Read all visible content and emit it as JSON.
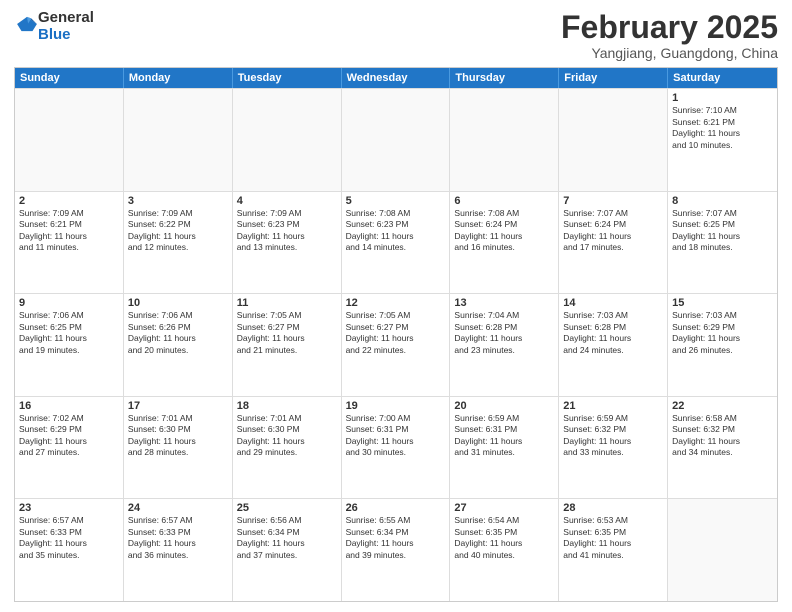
{
  "header": {
    "logo_general": "General",
    "logo_blue": "Blue",
    "title": "February 2025",
    "subtitle": "Yangjiang, Guangdong, China"
  },
  "calendar": {
    "days_of_week": [
      "Sunday",
      "Monday",
      "Tuesday",
      "Wednesday",
      "Thursday",
      "Friday",
      "Saturday"
    ],
    "rows": [
      [
        {
          "day": "",
          "empty": true
        },
        {
          "day": "",
          "empty": true
        },
        {
          "day": "",
          "empty": true
        },
        {
          "day": "",
          "empty": true
        },
        {
          "day": "",
          "empty": true
        },
        {
          "day": "",
          "empty": true
        },
        {
          "day": "1",
          "info": "Sunrise: 7:10 AM\nSunset: 6:21 PM\nDaylight: 11 hours\nand 10 minutes."
        }
      ],
      [
        {
          "day": "2",
          "info": "Sunrise: 7:09 AM\nSunset: 6:21 PM\nDaylight: 11 hours\nand 11 minutes."
        },
        {
          "day": "3",
          "info": "Sunrise: 7:09 AM\nSunset: 6:22 PM\nDaylight: 11 hours\nand 12 minutes."
        },
        {
          "day": "4",
          "info": "Sunrise: 7:09 AM\nSunset: 6:23 PM\nDaylight: 11 hours\nand 13 minutes."
        },
        {
          "day": "5",
          "info": "Sunrise: 7:08 AM\nSunset: 6:23 PM\nDaylight: 11 hours\nand 14 minutes."
        },
        {
          "day": "6",
          "info": "Sunrise: 7:08 AM\nSunset: 6:24 PM\nDaylight: 11 hours\nand 16 minutes."
        },
        {
          "day": "7",
          "info": "Sunrise: 7:07 AM\nSunset: 6:24 PM\nDaylight: 11 hours\nand 17 minutes."
        },
        {
          "day": "8",
          "info": "Sunrise: 7:07 AM\nSunset: 6:25 PM\nDaylight: 11 hours\nand 18 minutes."
        }
      ],
      [
        {
          "day": "9",
          "info": "Sunrise: 7:06 AM\nSunset: 6:25 PM\nDaylight: 11 hours\nand 19 minutes."
        },
        {
          "day": "10",
          "info": "Sunrise: 7:06 AM\nSunset: 6:26 PM\nDaylight: 11 hours\nand 20 minutes."
        },
        {
          "day": "11",
          "info": "Sunrise: 7:05 AM\nSunset: 6:27 PM\nDaylight: 11 hours\nand 21 minutes."
        },
        {
          "day": "12",
          "info": "Sunrise: 7:05 AM\nSunset: 6:27 PM\nDaylight: 11 hours\nand 22 minutes."
        },
        {
          "day": "13",
          "info": "Sunrise: 7:04 AM\nSunset: 6:28 PM\nDaylight: 11 hours\nand 23 minutes."
        },
        {
          "day": "14",
          "info": "Sunrise: 7:03 AM\nSunset: 6:28 PM\nDaylight: 11 hours\nand 24 minutes."
        },
        {
          "day": "15",
          "info": "Sunrise: 7:03 AM\nSunset: 6:29 PM\nDaylight: 11 hours\nand 26 minutes."
        }
      ],
      [
        {
          "day": "16",
          "info": "Sunrise: 7:02 AM\nSunset: 6:29 PM\nDaylight: 11 hours\nand 27 minutes."
        },
        {
          "day": "17",
          "info": "Sunrise: 7:01 AM\nSunset: 6:30 PM\nDaylight: 11 hours\nand 28 minutes."
        },
        {
          "day": "18",
          "info": "Sunrise: 7:01 AM\nSunset: 6:30 PM\nDaylight: 11 hours\nand 29 minutes."
        },
        {
          "day": "19",
          "info": "Sunrise: 7:00 AM\nSunset: 6:31 PM\nDaylight: 11 hours\nand 30 minutes."
        },
        {
          "day": "20",
          "info": "Sunrise: 6:59 AM\nSunset: 6:31 PM\nDaylight: 11 hours\nand 31 minutes."
        },
        {
          "day": "21",
          "info": "Sunrise: 6:59 AM\nSunset: 6:32 PM\nDaylight: 11 hours\nand 33 minutes."
        },
        {
          "day": "22",
          "info": "Sunrise: 6:58 AM\nSunset: 6:32 PM\nDaylight: 11 hours\nand 34 minutes."
        }
      ],
      [
        {
          "day": "23",
          "info": "Sunrise: 6:57 AM\nSunset: 6:33 PM\nDaylight: 11 hours\nand 35 minutes."
        },
        {
          "day": "24",
          "info": "Sunrise: 6:57 AM\nSunset: 6:33 PM\nDaylight: 11 hours\nand 36 minutes."
        },
        {
          "day": "25",
          "info": "Sunrise: 6:56 AM\nSunset: 6:34 PM\nDaylight: 11 hours\nand 37 minutes."
        },
        {
          "day": "26",
          "info": "Sunrise: 6:55 AM\nSunset: 6:34 PM\nDaylight: 11 hours\nand 39 minutes."
        },
        {
          "day": "27",
          "info": "Sunrise: 6:54 AM\nSunset: 6:35 PM\nDaylight: 11 hours\nand 40 minutes."
        },
        {
          "day": "28",
          "info": "Sunrise: 6:53 AM\nSunset: 6:35 PM\nDaylight: 11 hours\nand 41 minutes."
        },
        {
          "day": "",
          "empty": true
        }
      ]
    ]
  }
}
